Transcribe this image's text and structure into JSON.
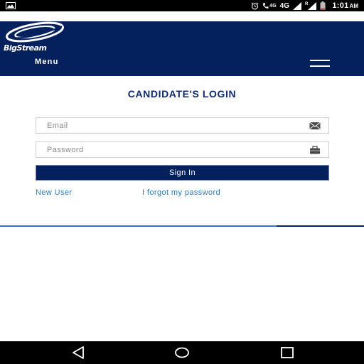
{
  "status_bar": {
    "network": "4G",
    "network_small": "4G",
    "signal_letter": "R",
    "time": "1:01",
    "ampm": "AM",
    "icons": [
      "image-notification-icon",
      "alarm-icon",
      "phone-volte-icon",
      "signal-icon",
      "battery-icon"
    ]
  },
  "header": {
    "logo_text": "BigStream",
    "menu_label": "Menu",
    "background": "#05215d"
  },
  "login": {
    "title": "CANDIDATE'S LOGIN",
    "email_placeholder": "Email",
    "password_placeholder": "Password",
    "sign_in_label": "Sign In",
    "new_user_label": "New User",
    "forgot_label": "I forgot my password",
    "link_color": "#2c7cb5",
    "title_color": "#0d2b6c"
  },
  "progress": {
    "fraction": 0.76
  },
  "nav": {
    "icons": [
      "back-icon",
      "home-icon",
      "recent-apps-icon"
    ]
  }
}
